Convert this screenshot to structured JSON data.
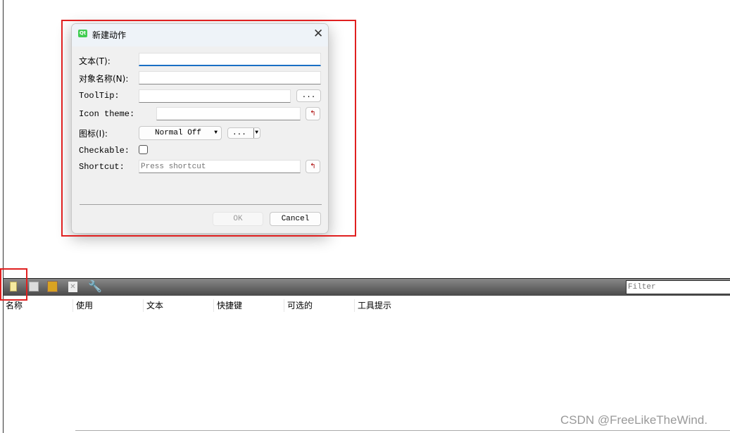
{
  "dialog": {
    "title": "新建动作",
    "close_icon": "close-icon",
    "text_label": "文本(T):",
    "text_value": "",
    "object_name_label": "对象名称(N):",
    "object_name_value": "",
    "tooltip_label": "ToolTip:",
    "tooltip_value": "",
    "tooltip_more": "...",
    "icon_theme_label": "Icon theme:",
    "icon_theme_value": "",
    "icon_label": "图标(I):",
    "icon_state": "Normal Off",
    "icon_more": "...",
    "checkable_label": "Checkable:",
    "checkable": false,
    "shortcut_label": "Shortcut:",
    "shortcut_placeholder": "Press shortcut",
    "ok": "OK",
    "cancel": "Cancel"
  },
  "toolbar": {
    "icons": [
      "new-action-icon",
      "copy-icon",
      "paste-icon",
      "delete-icon",
      "configure-icon"
    ],
    "filter_placeholder": "Filter"
  },
  "table": {
    "columns": [
      "名称",
      "使用",
      "文本",
      "快捷键",
      "可选的",
      "工具提示"
    ]
  },
  "watermark": "CSDN @FreeLikeTheWind.",
  "colors": {
    "highlight": "#e02020",
    "accent": "#1a6fc4"
  }
}
